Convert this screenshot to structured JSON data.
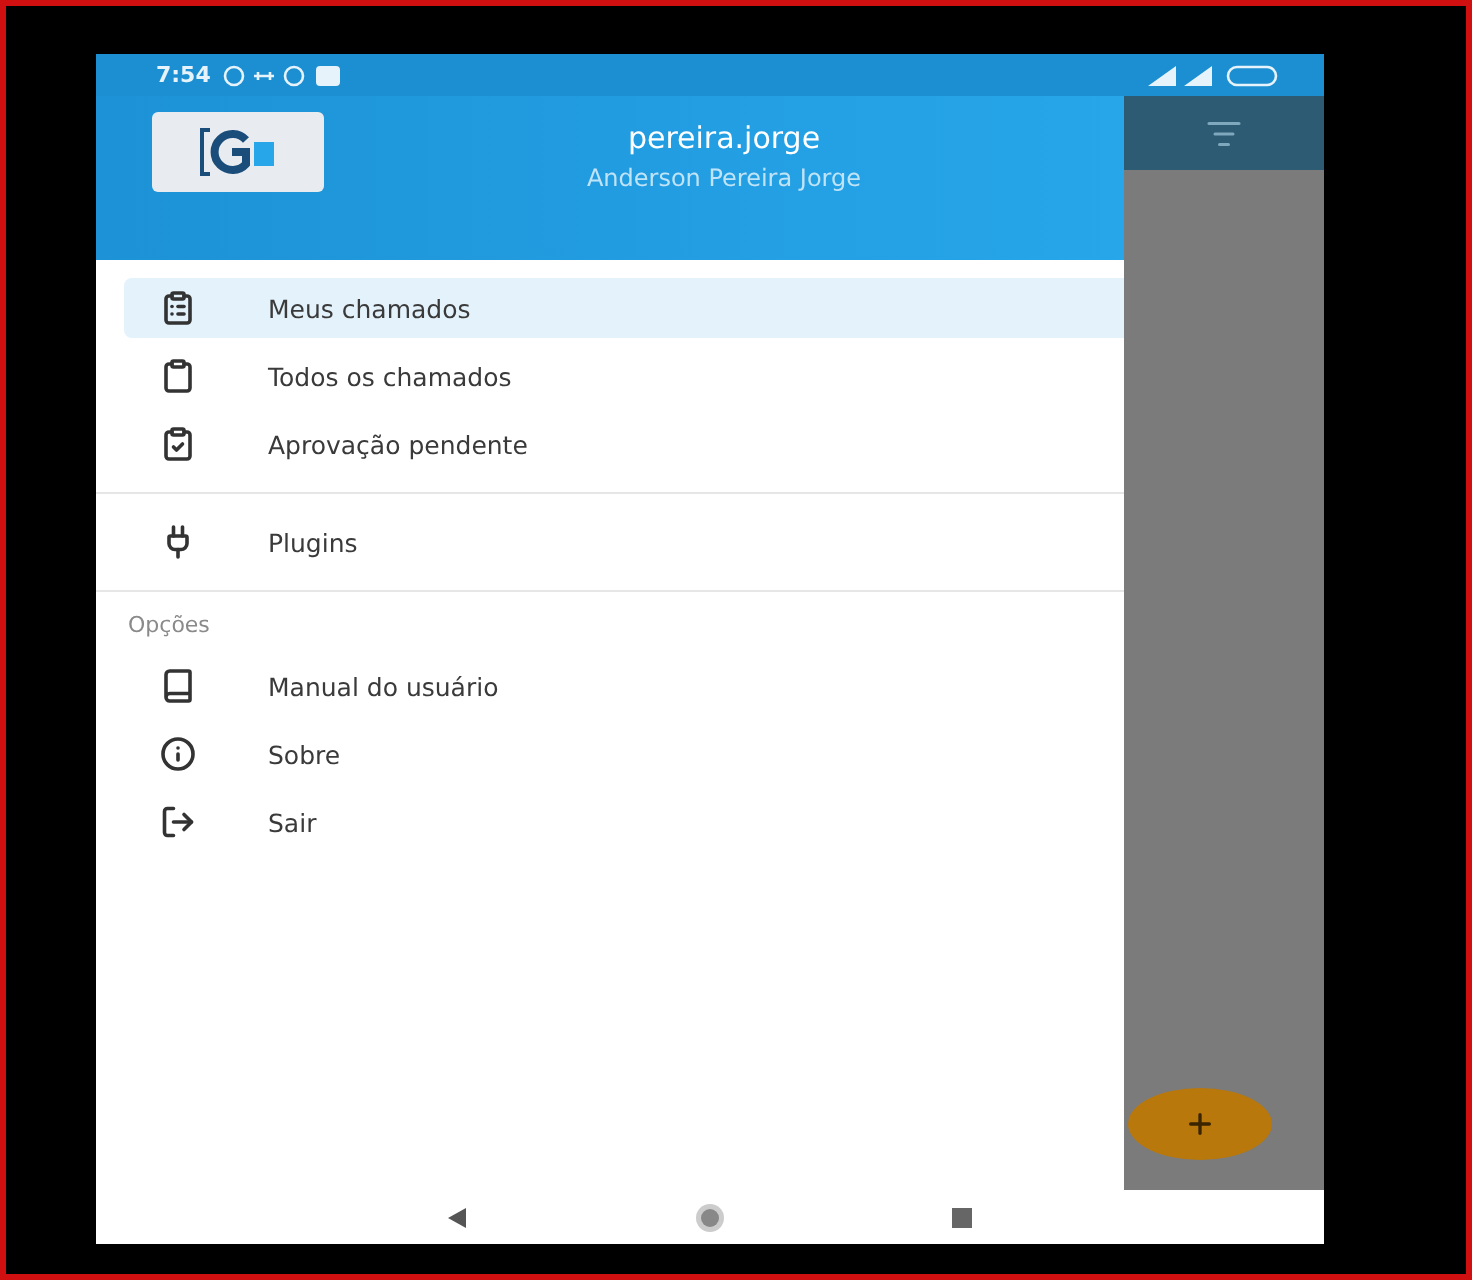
{
  "status_bar": {
    "time": "7:54"
  },
  "drawer_header": {
    "username": "pereira.jorge",
    "full_name": "Anderson Pereira Jorge"
  },
  "menu_groups": [
    {
      "items": [
        {
          "label": "Meus chamados",
          "selected": true
        },
        {
          "label": "Todos os chamados",
          "selected": false
        },
        {
          "label": "Aprovação pendente",
          "selected": false
        }
      ]
    },
    {
      "items": [
        {
          "label": "Plugins",
          "selected": false
        }
      ]
    },
    {
      "heading": "Opções",
      "items": [
        {
          "label": "Manual do usuário",
          "selected": false
        },
        {
          "label": "Sobre",
          "selected": false
        },
        {
          "label": "Sair",
          "selected": false
        }
      ]
    }
  ]
}
